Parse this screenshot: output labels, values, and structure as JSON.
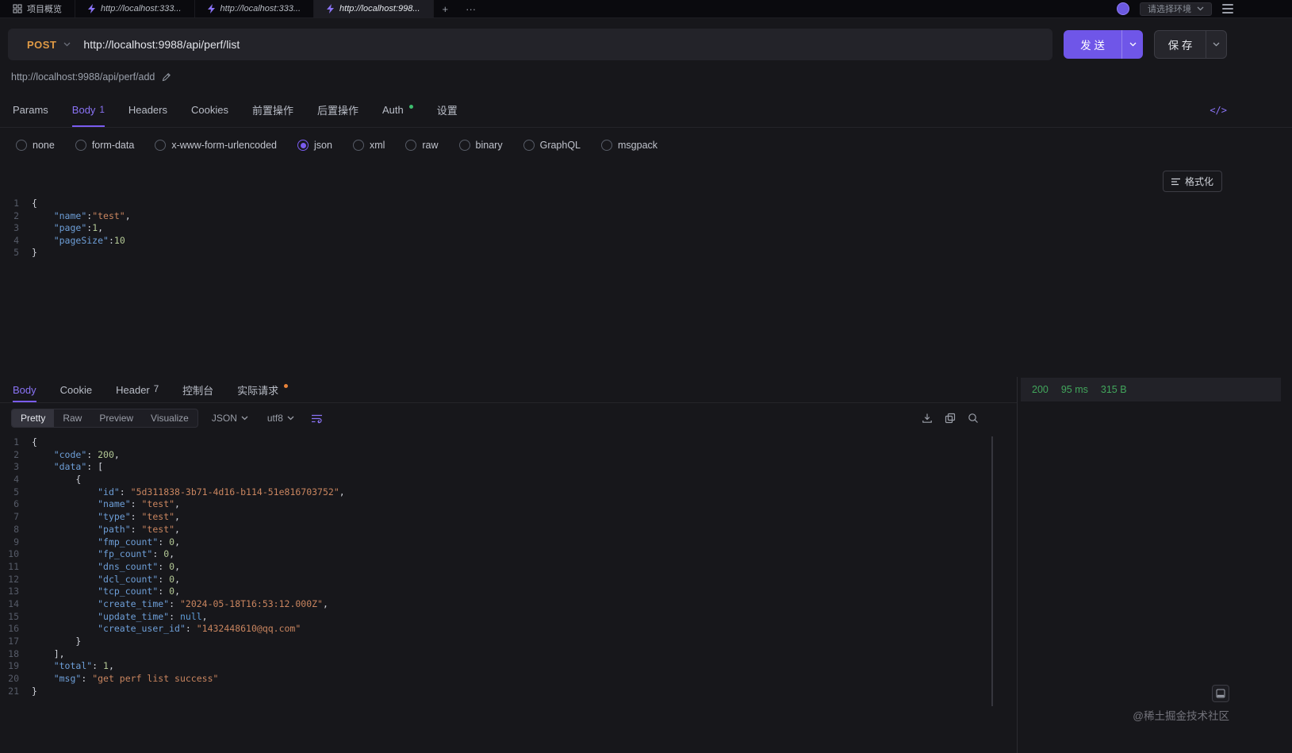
{
  "colors": {
    "accent": "#7a5cf0",
    "method": "#e09a45",
    "success": "#42a65c"
  },
  "topbar": {
    "tabs": [
      {
        "label": "项目概览"
      },
      {
        "label": "http://localhost:333..."
      },
      {
        "label": "http://localhost:333..."
      },
      {
        "label": "http://localhost:998..."
      }
    ],
    "new_tab": "+",
    "more": "···",
    "env_selector": "请选择环境"
  },
  "request": {
    "method": "POST",
    "url": "http://localhost:9988/api/perf/list",
    "send": "发 送",
    "save": "保 存",
    "saved_url": "http://localhost:9988/api/perf/add"
  },
  "request_tabs": {
    "params": "Params",
    "body": "Body",
    "body_count": "1",
    "headers": "Headers",
    "cookies": "Cookies",
    "pre_ops": "前置操作",
    "post_ops": "后置操作",
    "auth": "Auth",
    "settings": "设置",
    "code_icon": "</>"
  },
  "body_types": [
    "none",
    "form-data",
    "x-www-form-urlencoded",
    "json",
    "xml",
    "raw",
    "binary",
    "GraphQL",
    "msgpack"
  ],
  "request_editor": {
    "format_button": "格式化",
    "lines": [
      [
        [
          "punct",
          "{"
        ]
      ],
      [
        [
          "punct",
          "    "
        ],
        [
          "key",
          "\"name\""
        ],
        [
          "punct",
          ":"
        ],
        [
          "str",
          "\"test\""
        ],
        [
          "punct",
          ","
        ]
      ],
      [
        [
          "punct",
          "    "
        ],
        [
          "key",
          "\"page\""
        ],
        [
          "punct",
          ":"
        ],
        [
          "num",
          "1"
        ],
        [
          "punct",
          ","
        ]
      ],
      [
        [
          "punct",
          "    "
        ],
        [
          "key",
          "\"pageSize\""
        ],
        [
          "punct",
          ":"
        ],
        [
          "num",
          "10"
        ]
      ],
      [
        [
          "punct",
          "}"
        ]
      ]
    ]
  },
  "response": {
    "tabs": {
      "body": "Body",
      "cookie": "Cookie",
      "header": "Header",
      "header_count": "7",
      "console": "控制台",
      "actual_request": "实际请求"
    },
    "status": {
      "code": "200",
      "time": "95 ms",
      "size": "315 B"
    },
    "views": [
      "Pretty",
      "Raw",
      "Preview",
      "Visualize"
    ],
    "format": "JSON",
    "encoding": "utf8",
    "lines": [
      [
        [
          "punct",
          "{"
        ]
      ],
      [
        [
          "punct",
          "    "
        ],
        [
          "key",
          "\"code\""
        ],
        [
          "punct",
          ": "
        ],
        [
          "num",
          "200"
        ],
        [
          "punct",
          ","
        ]
      ],
      [
        [
          "punct",
          "    "
        ],
        [
          "key",
          "\"data\""
        ],
        [
          "punct",
          ": ["
        ]
      ],
      [
        [
          "punct",
          "        {"
        ]
      ],
      [
        [
          "punct",
          "            "
        ],
        [
          "key",
          "\"id\""
        ],
        [
          "punct",
          ": "
        ],
        [
          "str",
          "\"5d311838-3b71-4d16-b114-51e816703752\""
        ],
        [
          "punct",
          ","
        ]
      ],
      [
        [
          "punct",
          "            "
        ],
        [
          "key",
          "\"name\""
        ],
        [
          "punct",
          ": "
        ],
        [
          "str",
          "\"test\""
        ],
        [
          "punct",
          ","
        ]
      ],
      [
        [
          "punct",
          "            "
        ],
        [
          "key",
          "\"type\""
        ],
        [
          "punct",
          ": "
        ],
        [
          "str",
          "\"test\""
        ],
        [
          "punct",
          ","
        ]
      ],
      [
        [
          "punct",
          "            "
        ],
        [
          "key",
          "\"path\""
        ],
        [
          "punct",
          ": "
        ],
        [
          "str",
          "\"test\""
        ],
        [
          "punct",
          ","
        ]
      ],
      [
        [
          "punct",
          "            "
        ],
        [
          "key",
          "\"fmp_count\""
        ],
        [
          "punct",
          ": "
        ],
        [
          "num",
          "0"
        ],
        [
          "punct",
          ","
        ]
      ],
      [
        [
          "punct",
          "            "
        ],
        [
          "key",
          "\"fp_count\""
        ],
        [
          "punct",
          ": "
        ],
        [
          "num",
          "0"
        ],
        [
          "punct",
          ","
        ]
      ],
      [
        [
          "punct",
          "            "
        ],
        [
          "key",
          "\"dns_count\""
        ],
        [
          "punct",
          ": "
        ],
        [
          "num",
          "0"
        ],
        [
          "punct",
          ","
        ]
      ],
      [
        [
          "punct",
          "            "
        ],
        [
          "key",
          "\"dcl_count\""
        ],
        [
          "punct",
          ": "
        ],
        [
          "num",
          "0"
        ],
        [
          "punct",
          ","
        ]
      ],
      [
        [
          "punct",
          "            "
        ],
        [
          "key",
          "\"tcp_count\""
        ],
        [
          "punct",
          ": "
        ],
        [
          "num",
          "0"
        ],
        [
          "punct",
          ","
        ]
      ],
      [
        [
          "punct",
          "            "
        ],
        [
          "key",
          "\"create_time\""
        ],
        [
          "punct",
          ": "
        ],
        [
          "str",
          "\"2024-05-18T16:53:12.000Z\""
        ],
        [
          "punct",
          ","
        ]
      ],
      [
        [
          "punct",
          "            "
        ],
        [
          "key",
          "\"update_time\""
        ],
        [
          "punct",
          ": "
        ],
        [
          "null",
          "null"
        ],
        [
          "punct",
          ","
        ]
      ],
      [
        [
          "punct",
          "            "
        ],
        [
          "key",
          "\"create_user_id\""
        ],
        [
          "punct",
          ": "
        ],
        [
          "str",
          "\"1432448610@qq.com\""
        ]
      ],
      [
        [
          "punct",
          "        }"
        ]
      ],
      [
        [
          "punct",
          "    ],"
        ]
      ],
      [
        [
          "punct",
          "    "
        ],
        [
          "key",
          "\"total\""
        ],
        [
          "punct",
          ": "
        ],
        [
          "num",
          "1"
        ],
        [
          "punct",
          ","
        ]
      ],
      [
        [
          "punct",
          "    "
        ],
        [
          "key",
          "\"msg\""
        ],
        [
          "punct",
          ": "
        ],
        [
          "str",
          "\"get perf list success\""
        ]
      ],
      [
        [
          "punct",
          "}"
        ]
      ]
    ]
  },
  "watermark": "@稀土掘金技术社区"
}
